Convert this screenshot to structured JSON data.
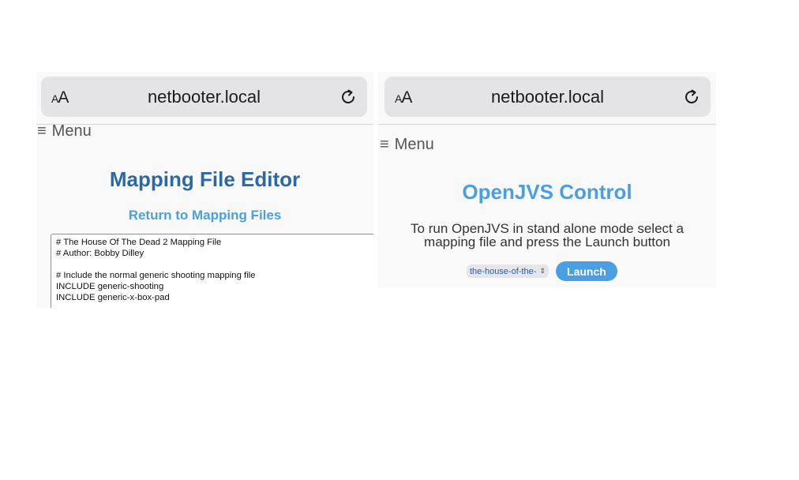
{
  "left": {
    "address_bar": {
      "text_size_label": "AA",
      "host": "netbooter.local"
    },
    "menu_label": "Menu",
    "title": "Mapping File Editor",
    "return_link": "Return to Mapping Files",
    "editor_lines": [
      "# The House Of The Dead 2 Mapping File",
      "# Author: Bobby Dilley",
      "",
      "# Include the normal generic shooting mapping file",
      "INCLUDE generic-shooting",
      "INCLUDE generic-x-box-pad"
    ]
  },
  "right": {
    "address_bar": {
      "text_size_label": "AA",
      "host": "netbooter.local"
    },
    "menu_label": "Menu",
    "title": "OpenJVS Control",
    "description_line1": "To run OpenJVS in stand alone mode select a",
    "description_line2": "mapping file and press the Launch button",
    "mapping_select_value": "the-house-of-the-",
    "launch_label": "Launch"
  },
  "icons": {
    "reload": "reload-icon",
    "menu": "hamburger-menu-icon",
    "select": "chevron-up-down-icon"
  },
  "colors": {
    "title_dark_blue": "#2a69a8",
    "accent_blue": "#4a9fe3",
    "address_bar_bg": "#e4e3e6"
  }
}
